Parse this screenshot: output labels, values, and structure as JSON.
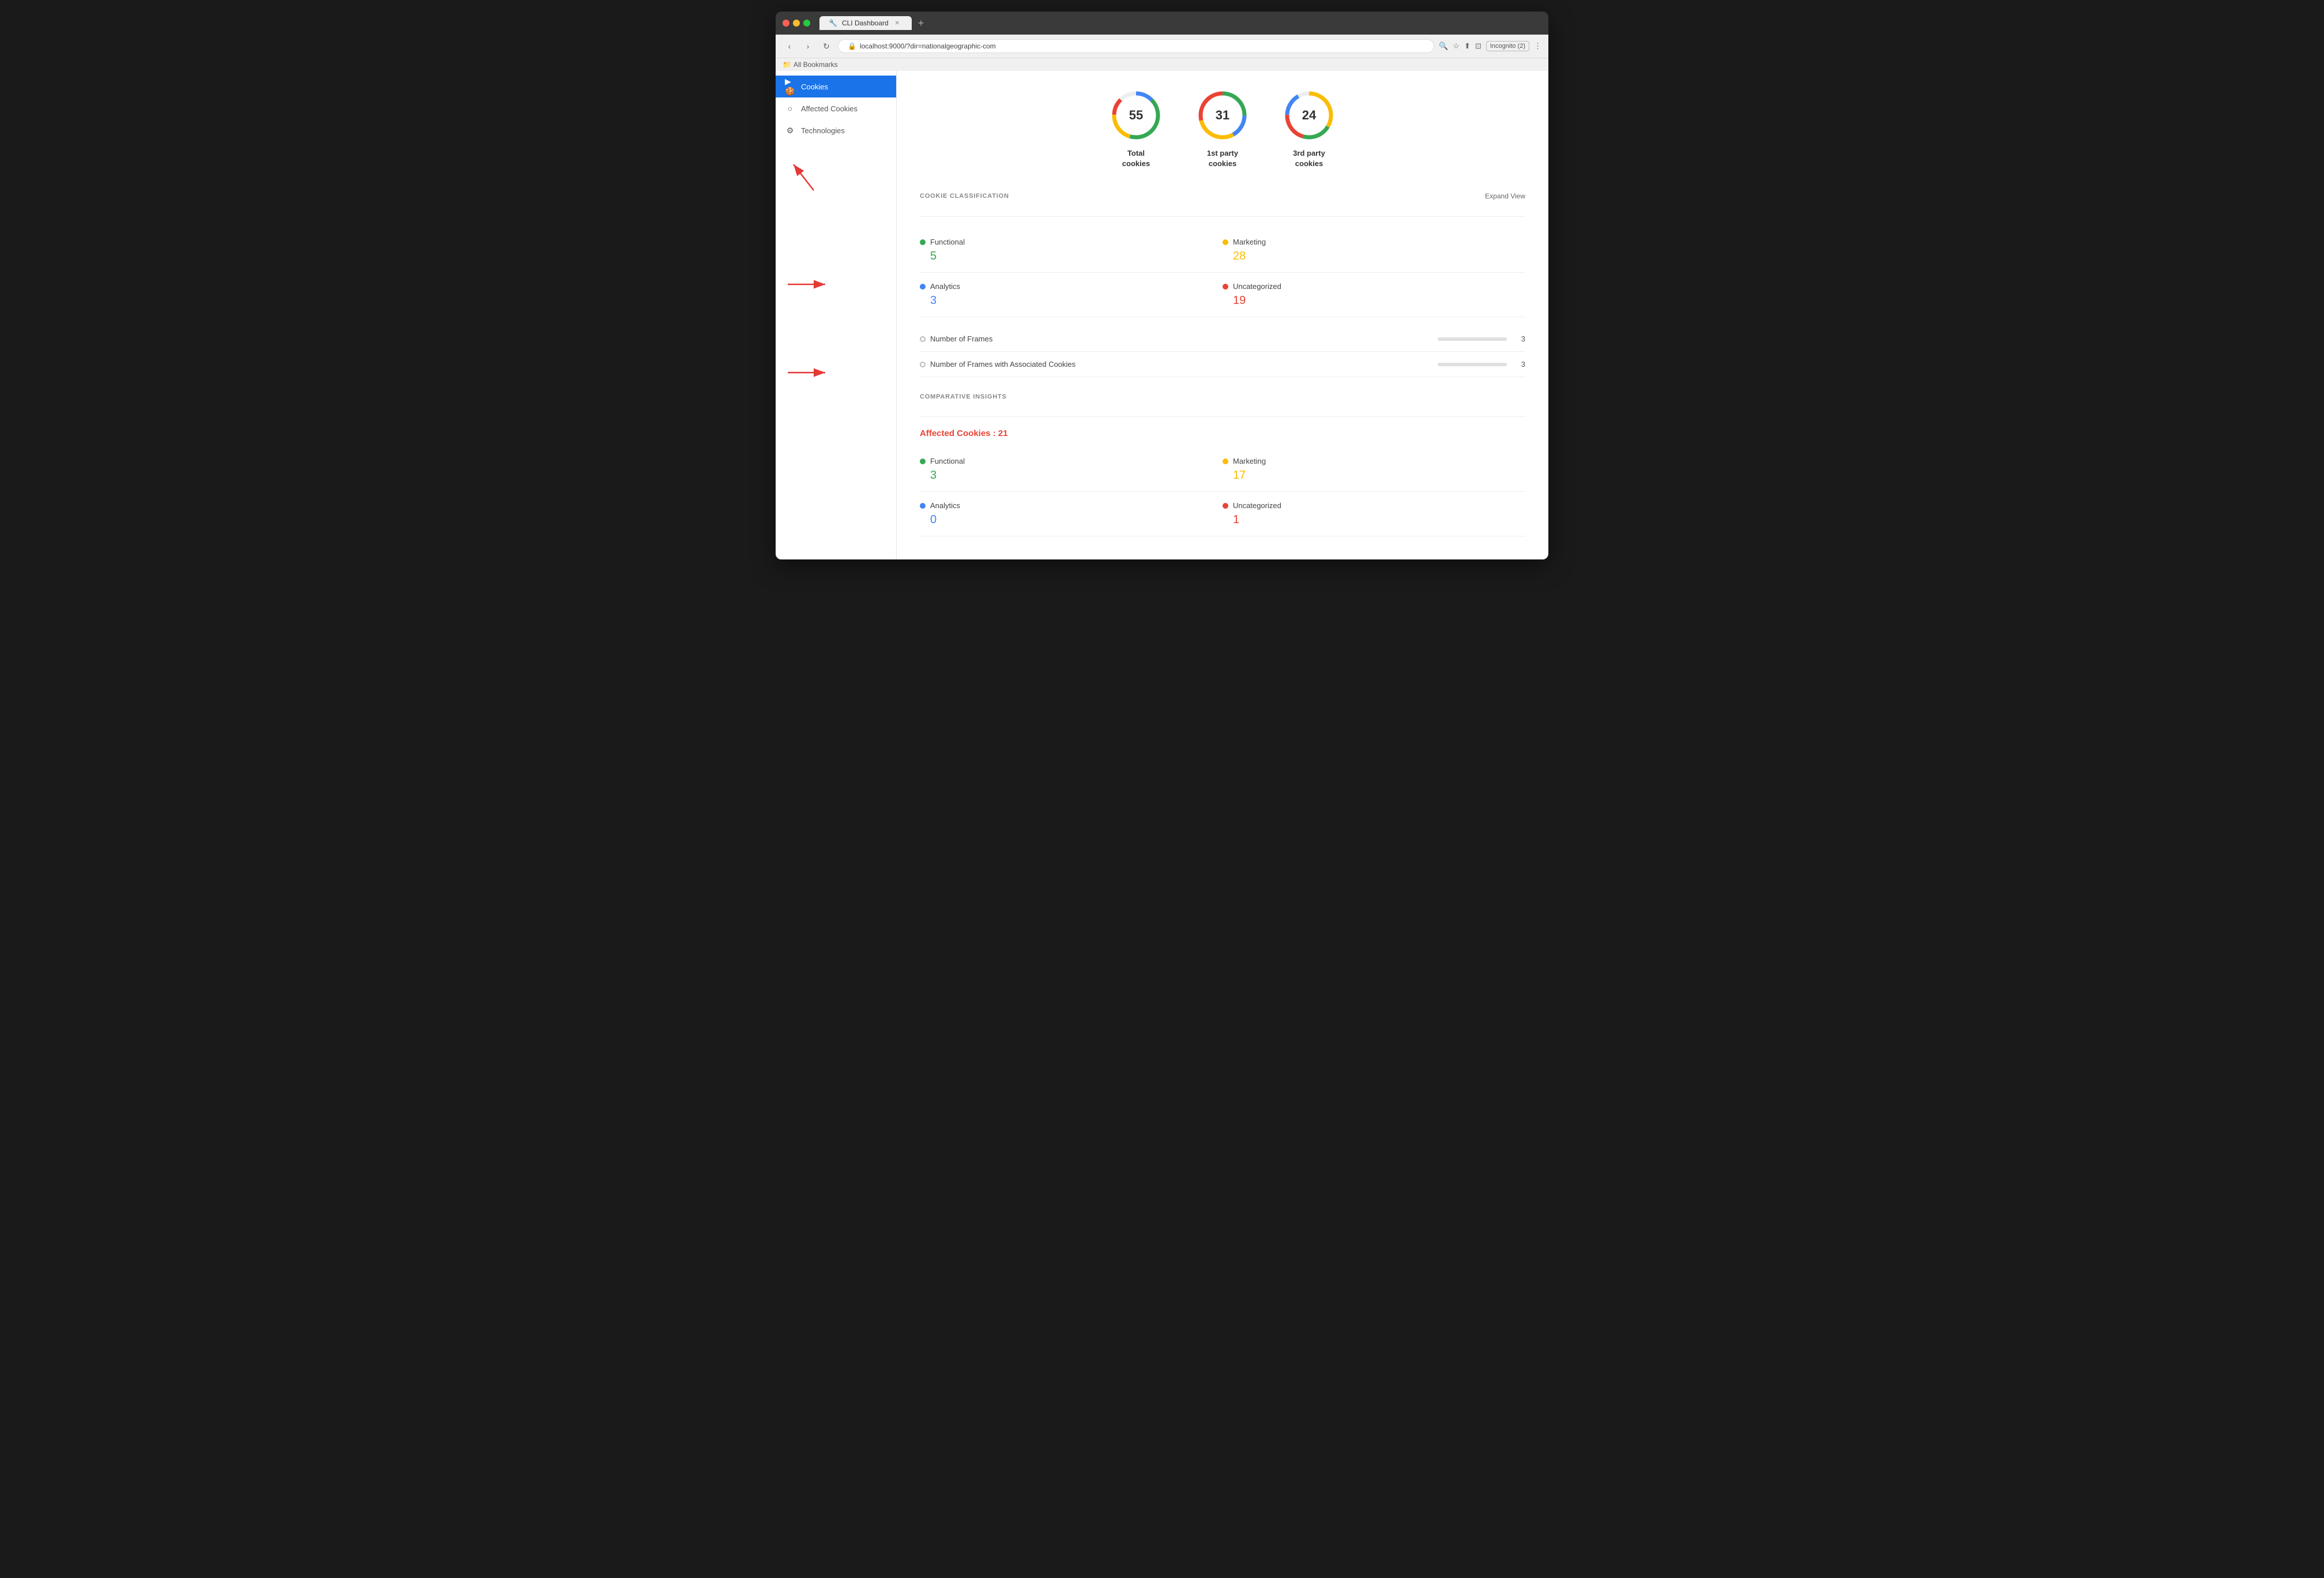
{
  "browser": {
    "tab_title": "CLI Dashboard",
    "url": "localhost:9000/?dir=nationalgeographic-com",
    "new_tab_symbol": "+",
    "nav_back": "‹",
    "nav_forward": "›",
    "nav_reload": "↻",
    "bookmarks_label": "All Bookmarks",
    "incognito_label": "Incognito (2)"
  },
  "sidebar": {
    "items": [
      {
        "id": "cookies",
        "label": "Cookies",
        "icon": "🍪",
        "active": true
      },
      {
        "id": "affected-cookies",
        "label": "Affected Cookies",
        "icon": "○"
      },
      {
        "id": "technologies",
        "label": "Technologies",
        "icon": "⚙"
      }
    ]
  },
  "stats": [
    {
      "id": "total",
      "value": "55",
      "label": "Total\ncookies",
      "color1": "#4285f4",
      "color2": "#34a853",
      "color3": "#fbbc04",
      "color4": "#ea4335"
    },
    {
      "id": "first-party",
      "value": "31",
      "label": "1st party\ncookies",
      "color1": "#34a853",
      "color2": "#4285f4",
      "color3": "#fbbc04",
      "color4": "#ea4335"
    },
    {
      "id": "third-party",
      "value": "24",
      "label": "3rd party\ncookies",
      "color1": "#fbbc04",
      "color2": "#34a853",
      "color3": "#ea4335",
      "color4": "#4285f4"
    }
  ],
  "cookie_classification": {
    "section_title": "COOKIE CLASSIFICATION",
    "expand_btn": "Expand View",
    "items": [
      {
        "id": "functional",
        "label": "Functional",
        "value": "5",
        "dot_class": "dot-green",
        "value_class": "value-green"
      },
      {
        "id": "marketing",
        "label": "Marketing",
        "value": "28",
        "dot_class": "dot-orange",
        "value_class": "value-orange"
      },
      {
        "id": "analytics",
        "label": "Analytics",
        "value": "3",
        "dot_class": "dot-blue",
        "value_class": "value-blue"
      },
      {
        "id": "uncategorized",
        "label": "Uncategorized",
        "value": "19",
        "dot_class": "dot-red",
        "value_class": "value-red"
      }
    ],
    "frames": [
      {
        "id": "num-frames",
        "label": "Number of Frames",
        "value": "3"
      },
      {
        "id": "frames-with-cookies",
        "label": "Number of Frames with Associated Cookies",
        "value": "3"
      }
    ]
  },
  "comparative_insights": {
    "section_title": "COMPARATIVE INSIGHTS",
    "affected_cookies_label": "Affected Cookies : 21",
    "items": [
      {
        "id": "functional-ci",
        "label": "Functional",
        "value": "3",
        "dot_class": "dot-green",
        "value_class": "value-green"
      },
      {
        "id": "marketing-ci",
        "label": "Marketing",
        "value": "17",
        "dot_class": "dot-orange",
        "value_class": "value-orange"
      },
      {
        "id": "analytics-ci",
        "label": "Analytics",
        "value": "0",
        "dot_class": "dot-blue",
        "value_class": "value-blue"
      },
      {
        "id": "uncategorized-ci",
        "label": "Uncategorized",
        "value": "1",
        "dot_class": "dot-red",
        "value_class": "value-red"
      }
    ]
  }
}
